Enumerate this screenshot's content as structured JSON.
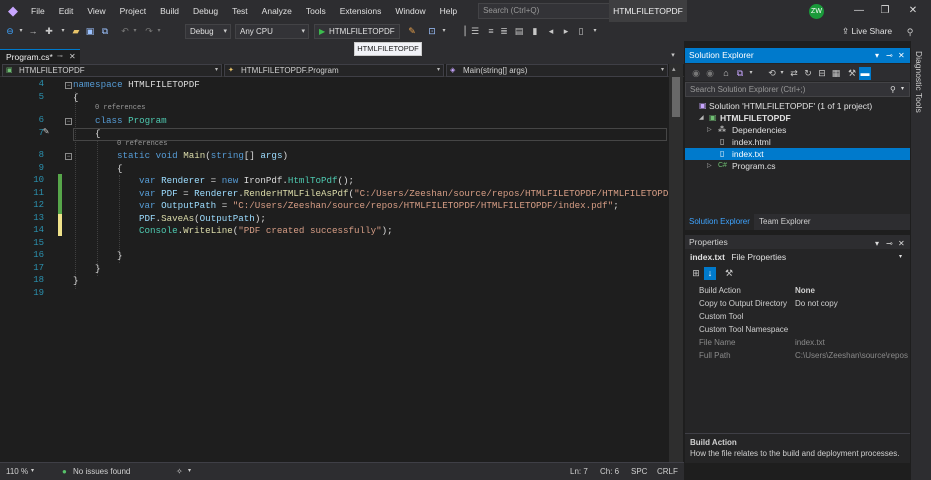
{
  "menu": [
    "File",
    "Edit",
    "View",
    "Project",
    "Build",
    "Debug",
    "Test",
    "Analyze",
    "Tools",
    "Extensions",
    "Window",
    "Help"
  ],
  "search_placeholder": "Search (Ctrl+Q)",
  "solution_name": "HTMLFILETOPDF",
  "user_initials": "ZW",
  "live_share": "Live Share",
  "toolbar": {
    "config": "Debug",
    "platform": "Any CPU",
    "run_target": "HTMLFILETOPDF",
    "tooltip": "HTMLFILETOPDF"
  },
  "tab": {
    "label": "Program.cs*"
  },
  "nav": {
    "project": "HTMLFILETOPDF",
    "class": "HTMLFILETOPDF.Program",
    "member": "Main(string[] args)"
  },
  "code": {
    "line_numbers": [
      "4",
      "5",
      "6",
      "7",
      "8",
      "9",
      "10",
      "11",
      "12",
      "13",
      "14",
      "15",
      "16",
      "17",
      "18",
      "19"
    ],
    "refs": "0 references"
  },
  "status": {
    "zoom": "110 %",
    "issues": "No issues found",
    "ln": "Ln: 7",
    "ch": "Ch: 6",
    "spc": "SPC",
    "crlf": "CRLF"
  },
  "solution_explorer": {
    "title": "Solution Explorer",
    "search_placeholder": "Search Solution Explorer (Ctrl+;)",
    "items": [
      "Solution 'HTMLFILETOPDF' (1 of 1 project)",
      "HTMLFILETOPDF",
      "Dependencies",
      "index.html",
      "index.txt",
      "Program.cs"
    ],
    "tabs": [
      "Solution Explorer",
      "Team Explorer"
    ]
  },
  "properties": {
    "title": "Properties",
    "object_name": "index.txt",
    "object_type": "File Properties",
    "rows": [
      {
        "name": "Build Action",
        "value": "None"
      },
      {
        "name": "Copy to Output Directory",
        "value": "Do not copy"
      },
      {
        "name": "Custom Tool",
        "value": ""
      },
      {
        "name": "Custom Tool Namespace",
        "value": ""
      },
      {
        "name": "File Name",
        "value": "index.txt"
      },
      {
        "name": "Full Path",
        "value": "C:\\Users\\Zeeshan\\source\\repos"
      }
    ],
    "desc_title": "Build Action",
    "desc_text": "How the file relates to the build and deployment processes."
  },
  "diagnostic_tools": "Diagnostic Tools",
  "colors": {
    "accent": "#007acc",
    "keyword": "#569cd6",
    "type": "#4ec9b0",
    "string": "#d69d85"
  }
}
